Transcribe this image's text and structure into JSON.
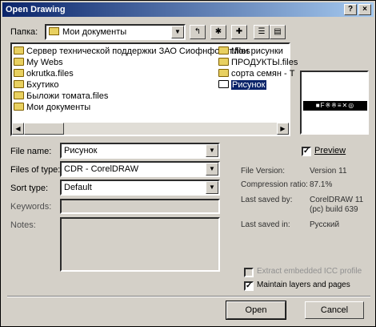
{
  "window": {
    "title": "Open Drawing"
  },
  "toolbar": {
    "lookin_label": "Папка:",
    "lookin_value": "Мои документы"
  },
  "files": [
    {
      "name": "Сервер технической поддержки ЗАО Сиофнфонет.files",
      "icon": "folder-icon"
    },
    {
      "name": "My Webs",
      "icon": "folder-icon"
    },
    {
      "name": "okrutka.files",
      "icon": "folder-icon"
    },
    {
      "name": "Бхутико",
      "icon": "folder-icon"
    },
    {
      "name": "Быложи томата.files",
      "icon": "folder-icon"
    },
    {
      "name": "Мои документы",
      "icon": "folder-icon"
    },
    {
      "name": "Мои рисунки",
      "icon": "folder-icon"
    },
    {
      "name": "ПРОДУКТЫ.files",
      "icon": "folder-icon"
    },
    {
      "name": "сорта семян - Т",
      "icon": "folder-icon"
    },
    {
      "name": "Рисунок",
      "icon": "drawing-file-icon",
      "selected": true
    }
  ],
  "form": {
    "filename_label": "File name:",
    "filename_value": "Рисунок",
    "filetype_label": "Files of type:",
    "filetype_value": "CDR - CorelDRAW",
    "sorttype_label": "Sort type:",
    "sorttype_value": "Default",
    "keywords_label": "Keywords:",
    "notes_label": "Notes:"
  },
  "preview": {
    "checkbox_label": "Preview",
    "checked": true,
    "thumbnail_text": "■F※※≡✕◎"
  },
  "fileinfo": {
    "version_label": "File Version:",
    "version_value": "Version 11",
    "compression_label": "Compression ratio:",
    "compression_value": "87.1%",
    "savedby_label": "Last saved by:",
    "savedby_value": "CorelDRAW 11 (pc) build 639",
    "savedin_label": "Last saved in:",
    "savedin_value": "Русский"
  },
  "options": {
    "extract_label": "Extract embedded ICC profile",
    "maintain_label": "Maintain layers and pages",
    "maintain_checked": true
  },
  "buttons": {
    "open": "Open",
    "cancel": "Cancel"
  }
}
